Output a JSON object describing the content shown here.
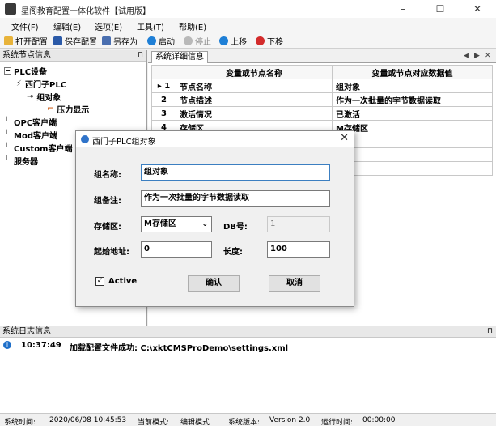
{
  "window": {
    "title": "星阁教育配置一体化软件【试用版】",
    "minimize": "–",
    "maximize": "☐",
    "close": "✕"
  },
  "menu": [
    "文件(F)",
    "编辑(E)",
    "选项(E)",
    "工具(T)",
    "帮助(E)"
  ],
  "toolbar": {
    "open": "打开配置",
    "save": "保存配置",
    "saveas": "另存为",
    "start": "启动",
    "stop": "停止",
    "up": "上移",
    "down": "下移"
  },
  "left_panel": {
    "title": "系统节点信息",
    "pin": "⊓"
  },
  "tree": {
    "plc": "PLC设备",
    "siemens": "西门子PLC",
    "group": "组对象",
    "pressure": "压力显示",
    "opc": "OPC客户端",
    "mod": "Mod客户端",
    "custom": "Custom客户端",
    "server": "服务器"
  },
  "right_panel": {
    "tab": "系统详细信息",
    "nav_prev": "◀",
    "nav_next": "▶",
    "close": "✕"
  },
  "grid": {
    "headers": [
      "变量或节点名称",
      "变量或节点对应数据值"
    ],
    "rows": [
      {
        "num": "1",
        "name": "节点名称",
        "value": "组对象"
      },
      {
        "num": "2",
        "name": "节点描述",
        "value": "作为一次批量的字节数据读取"
      },
      {
        "num": "3",
        "name": "激活情况",
        "value": "已激活"
      },
      {
        "num": "4",
        "name": "存储区",
        "value": "M存储区"
      }
    ]
  },
  "log_panel": {
    "title": "系统日志信息",
    "time": "10:37:49",
    "message": "加载配置文件成功: C:\\xktCMSProDemo\\settings.xml"
  },
  "status": {
    "time_label": "系统时间:",
    "time_value": "2020/06/08 10:45:53",
    "mode_label": "当前模式:",
    "mode_value": "编辑模式",
    "version_label": "系统版本:",
    "version_value": "Version  2.0",
    "runtime_label": "运行时间:",
    "runtime_value": "00:00:00"
  },
  "dialog": {
    "title": "西门子PLC组对象",
    "close": "✕",
    "name_label": "组名称:",
    "name_value": "组对象",
    "comment_label": "组备注:",
    "comment_value": "作为一次批量的字节数据读取",
    "area_label": "存储区:",
    "area_value": "M存储区",
    "db_label": "DB号:",
    "db_value": "1",
    "start_label": "起始地址:",
    "start_value": "0",
    "length_label": "长度:",
    "length_value": "100",
    "active_label": "Active",
    "active_checked": "✓",
    "ok": "确认",
    "cancel": "取消"
  }
}
